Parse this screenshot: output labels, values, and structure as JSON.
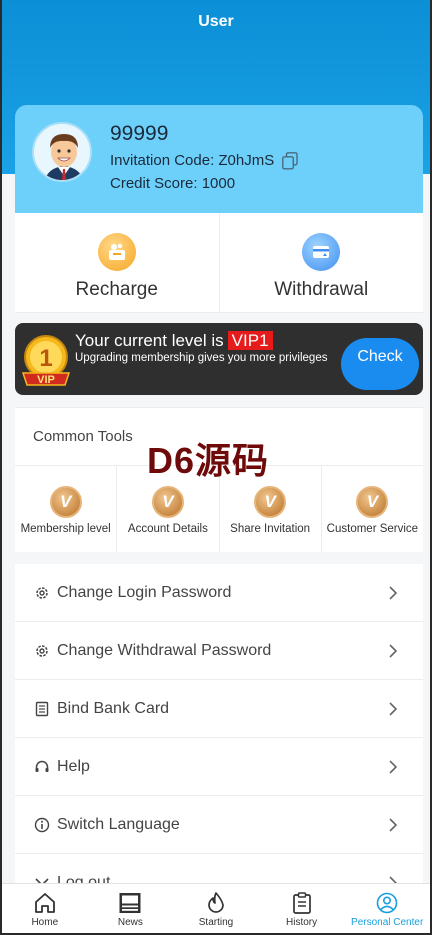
{
  "header": {
    "title": "User"
  },
  "profile": {
    "username": "99999",
    "invitation_code": "Invitation Code: Z0hJmS",
    "credit_score": "Credit Score: 1000"
  },
  "money": [
    {
      "label": "Recharge",
      "icon": "recharge-icon"
    },
    {
      "label": "Withdrawal",
      "icon": "withdrawal-icon"
    }
  ],
  "vip": {
    "prefix": "Your current level is",
    "level": "VIP1",
    "subtitle": "Upgrading membership gives you more privileges",
    "check_label": "Check",
    "badge_text": "VIP"
  },
  "tools": {
    "title": "Common Tools",
    "items": [
      {
        "label": "Membership level",
        "icon": "v-coin-icon"
      },
      {
        "label": "Account Details",
        "icon": "v-coin-icon"
      },
      {
        "label": "Share Invitation",
        "icon": "v-coin-icon"
      },
      {
        "label": "Customer Service",
        "icon": "v-coin-icon"
      }
    ]
  },
  "watermark": "D6源码",
  "menu": [
    {
      "label": "Change Login Password",
      "icon": "gear-icon"
    },
    {
      "label": "Change Withdrawal Password",
      "icon": "gear-icon"
    },
    {
      "label": "Bind Bank Card",
      "icon": "document-icon"
    },
    {
      "label": "Help",
      "icon": "headset-icon"
    },
    {
      "label": "Switch Language",
      "icon": "info-icon"
    },
    {
      "label": "Log out",
      "icon": "logout-icon"
    }
  ],
  "tabbar": [
    {
      "label": "Home",
      "icon": "home-icon"
    },
    {
      "label": "News",
      "icon": "news-icon"
    },
    {
      "label": "Starting",
      "icon": "flame-icon"
    },
    {
      "label": "History",
      "icon": "clipboard-icon"
    },
    {
      "label": "Personal Center",
      "icon": "user-icon",
      "active": true
    }
  ],
  "colors": {
    "header": "#0b8fd6",
    "card": "#6dd0fb",
    "accent": "#1a9ee0",
    "vip_tag": "#e61b1b",
    "check_button": "#1a8cf0"
  }
}
